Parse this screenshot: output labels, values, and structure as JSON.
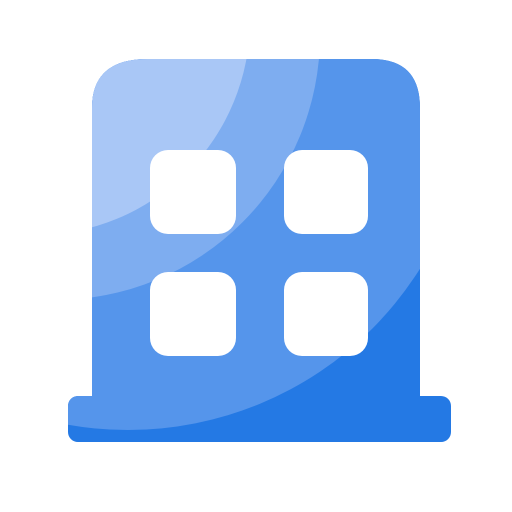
{
  "icon": {
    "name": "building-icon",
    "colors": {
      "background": "#ffffff",
      "window": "#ffffff",
      "tone_lightest": "#A9C7F6",
      "tone_light": "#7EADF0",
      "tone_mid": "#5595EB",
      "tone_dark": "#2479E4"
    }
  }
}
